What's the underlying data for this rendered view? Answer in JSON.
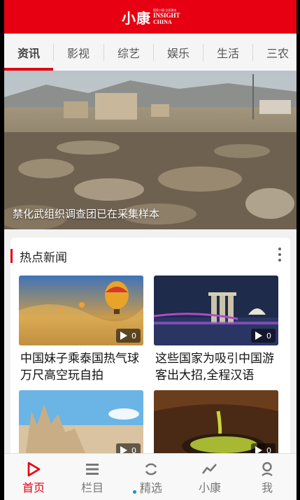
{
  "app": {
    "logo_cn": "小康",
    "logo_en_line1": "INSIGHT",
    "logo_en_line2": "CHINA",
    "logo_small": "国家小康·全面建成"
  },
  "colors": {
    "brand": "#e60012",
    "active_dot": "#1a8ce0"
  },
  "tabs": [
    {
      "label": "资讯",
      "active": true
    },
    {
      "label": "影视"
    },
    {
      "label": "综艺"
    },
    {
      "label": "娱乐"
    },
    {
      "label": "生活"
    },
    {
      "label": "三农"
    }
  ],
  "hero": {
    "caption": "禁化武组织调查团已在采集样本"
  },
  "hot_news": {
    "title": "热点新闻",
    "items": [
      {
        "title": "中国妹子乘泰国热气球万尺高空玩自拍",
        "views": "0",
        "image": "hot-air-balloon"
      },
      {
        "title": "这些国家为吸引中国游客出大招,全程汉语",
        "views": "0",
        "image": "marina-bay-night"
      },
      {
        "title": "",
        "views": "0",
        "image": "sand-castle"
      },
      {
        "title": "",
        "views": "0",
        "image": "matcha-pour"
      }
    ]
  },
  "bottom_nav": [
    {
      "label": "首页",
      "icon": "play-icon",
      "active": true
    },
    {
      "label": "栏目",
      "icon": "list-icon"
    },
    {
      "label": "精选",
      "icon": "refresh-icon"
    },
    {
      "label": "小康",
      "icon": "trend-icon"
    },
    {
      "label": "我",
      "icon": "user-icon"
    }
  ]
}
